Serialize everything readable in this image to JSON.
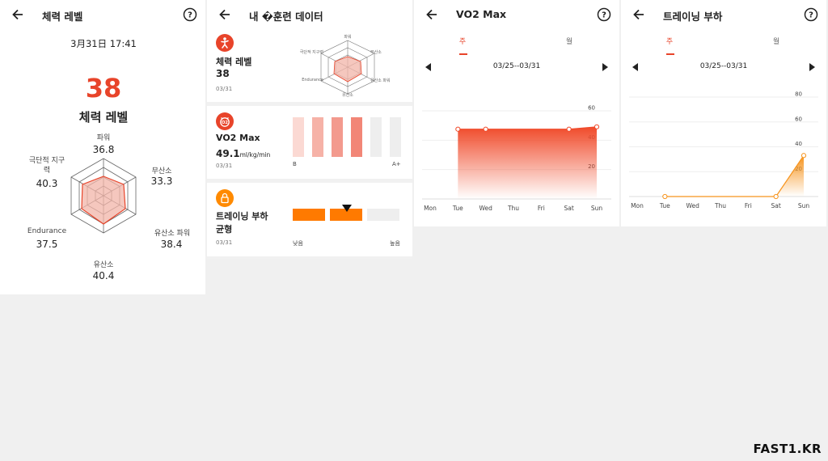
{
  "panel1": {
    "title": "체력 레벨",
    "datetime": "3月31日 17:41",
    "level": "38",
    "level_label": "체력 레벨",
    "radar": [
      {
        "label": "파워",
        "value": "36.8"
      },
      {
        "label": "무산소",
        "value": "33.3"
      },
      {
        "label": "유산소 파워",
        "value": "38.4"
      },
      {
        "label": "유산소",
        "value": "40.4"
      },
      {
        "label": "Endurance",
        "value": "37.5"
      },
      {
        "label_line1": "극단적 지구",
        "label_line2": "력",
        "value": "40.3"
      }
    ]
  },
  "panel2": {
    "title": "내 �훈련 데이터",
    "fitness": {
      "title": "체력 레벨",
      "value": "38",
      "date": "03/31",
      "radar_labels": {
        "top": "파워",
        "tr": "무산소",
        "br": "유산소 파워",
        "bottom": "유산소",
        "bl": "Endurance",
        "tl": "극단적 지구력"
      }
    },
    "vo2": {
      "title": "VO2 Max",
      "value": "49.1",
      "unit": "ml/kg/min",
      "date": "03/31",
      "scale_low": "B",
      "scale_high": "A+"
    },
    "load": {
      "title": "트레이닝 부하",
      "status": "균형",
      "date": "03/31",
      "scale_low": "낮음",
      "scale_high": "높음"
    }
  },
  "panel3": {
    "title": "VO2 Max",
    "tab_week": "주",
    "tab_month": "월",
    "range": "03/25--03/31",
    "chart_data": {
      "type": "area",
      "x": [
        "Mon",
        "Tue",
        "Wed",
        "Thu",
        "Fri",
        "Sat",
        "Sun"
      ],
      "y_ticks": [
        "20",
        "40",
        "60"
      ],
      "ylim": [
        0,
        60
      ],
      "points": [
        {
          "x": "Tue",
          "y": 47.5
        },
        {
          "x": "Wed",
          "y": 47.5
        },
        {
          "x": "Sat",
          "y": 47.5
        },
        {
          "x": "Sun",
          "y": 49.1
        }
      ],
      "color": "#f04a2a"
    }
  },
  "panel4": {
    "title": "트레이닝 부하",
    "tab_week": "주",
    "tab_month": "월",
    "range": "03/25--03/31",
    "chart_data": {
      "type": "area",
      "x": [
        "Mon",
        "Tue",
        "Wed",
        "Thu",
        "Fri",
        "Sat",
        "Sun"
      ],
      "y_ticks": [
        "20",
        "40",
        "60",
        "80"
      ],
      "ylim": [
        0,
        80
      ],
      "points": [
        {
          "x": "Tue",
          "y": 0
        },
        {
          "x": "Sat",
          "y": 0
        },
        {
          "x": "Sun",
          "y": 33
        }
      ],
      "color": "#f7941d"
    }
  },
  "watermark": "FAST1.KR",
  "colors": {
    "accent": "#e8442a",
    "orange": "#ff7a00",
    "vo2_bar": "#f39a8e",
    "vo2_bar_light": "#fbd9d3"
  }
}
